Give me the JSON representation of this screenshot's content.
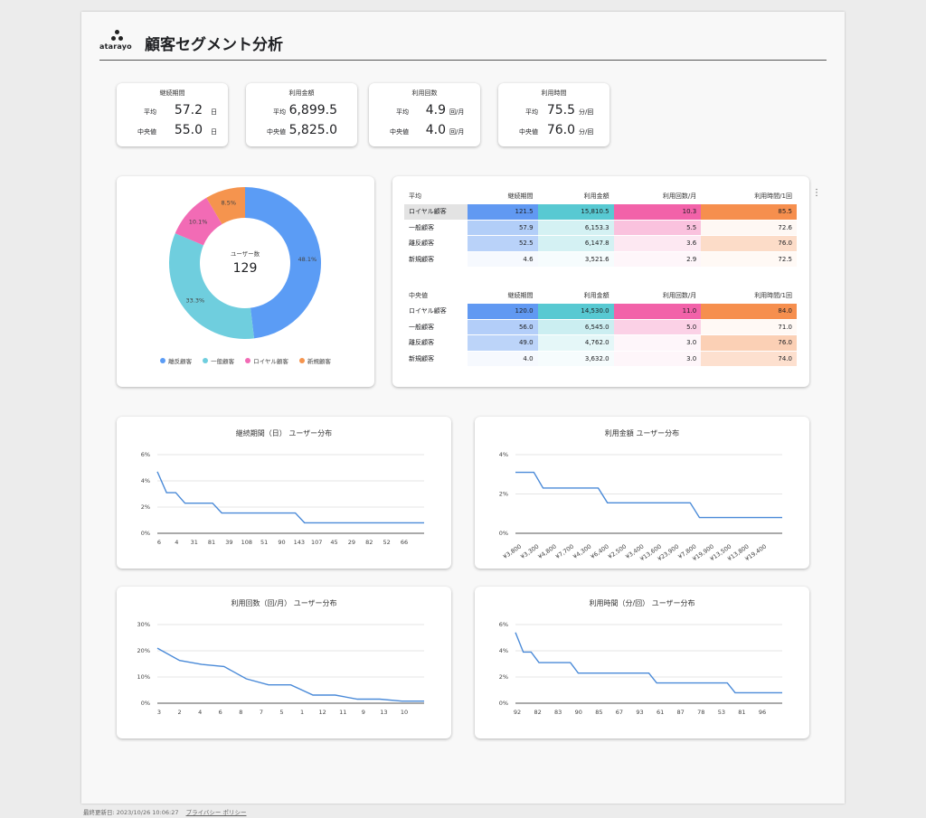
{
  "header": {
    "logo_text": "atarayo",
    "title": "顧客セグメント分析"
  },
  "kpis": [
    {
      "title": "継続期間",
      "avg_label": "平均",
      "avg": "57.2",
      "med_label": "中央値",
      "med": "55.0",
      "unit": "日"
    },
    {
      "title": "利用金額",
      "avg_label": "平均",
      "avg": "6,899.5",
      "med_label": "中央値",
      "med": "5,825.0",
      "unit": ""
    },
    {
      "title": "利用回数",
      "avg_label": "平均",
      "avg": "4.9",
      "med_label": "中央値",
      "med": "4.0",
      "unit": "回/月"
    },
    {
      "title": "利用時間",
      "avg_label": "平均",
      "avg": "75.5",
      "med_label": "中央値",
      "med": "76.0",
      "unit": "分/回"
    }
  ],
  "donut": {
    "center_label": "ユーザー数",
    "center_value": "129",
    "legend": [
      "離反顧客",
      "一般顧客",
      "ロイヤル顧客",
      "新規顧客"
    ]
  },
  "avg_table": {
    "headers": [
      "平均",
      "継続期間",
      "利用金額",
      "利用回数/月",
      "利用時間/1回"
    ],
    "rows": [
      [
        "ロイヤル顧客",
        "121.5",
        "15,810.5",
        "10.3",
        "85.5"
      ],
      [
        "一般顧客",
        "57.9",
        "6,153.3",
        "5.5",
        "72.6"
      ],
      [
        "離反顧客",
        "52.5",
        "6,147.8",
        "3.6",
        "76.0"
      ],
      [
        "新規顧客",
        "4.6",
        "3,521.6",
        "2.9",
        "72.5"
      ]
    ]
  },
  "med_table": {
    "headers": [
      "中央値",
      "継続期間",
      "利用金額",
      "利用回数/月",
      "利用時間/1回"
    ],
    "rows": [
      [
        "ロイヤル顧客",
        "120.0",
        "14,530.0",
        "11.0",
        "84.0"
      ],
      [
        "一般顧客",
        "56.0",
        "6,545.0",
        "5.0",
        "71.0"
      ],
      [
        "離反顧客",
        "49.0",
        "4,762.0",
        "3.0",
        "76.0"
      ],
      [
        "新規顧客",
        "4.0",
        "3,632.0",
        "3.0",
        "74.0"
      ]
    ]
  },
  "colors": {
    "blue": "#5b9cf5",
    "teal": "#6fcede",
    "pink": "#f26bb5",
    "orange": "#f5944e",
    "line": "#4a8ad8"
  },
  "footer": {
    "updated": "最終更新日: 2023/10/26 10:06:27",
    "privacy": "プライバシー ポリシー"
  },
  "chart_data": [
    {
      "type": "pie",
      "categories": [
        "離反顧客",
        "一般顧客",
        "ロイヤル顧客",
        "新規顧客"
      ],
      "values": [
        48.1,
        33.3,
        10.1,
        8.5
      ],
      "labels": [
        "48.1%",
        "33.3%",
        "10.1%",
        "8.5%"
      ],
      "total_label": "ユーザー数",
      "total": 129
    },
    {
      "type": "line",
      "title": "継続期間（日） ユーザー分布",
      "x": [
        "6",
        "4",
        "31",
        "81",
        "39",
        "108",
        "51",
        "90",
        "143",
        "107",
        "45",
        "29",
        "82",
        "52",
        "66"
      ],
      "y": [
        4.7,
        3.1,
        3.1,
        2.3,
        2.3,
        2.3,
        2.3,
        1.55,
        1.55,
        1.55,
        1.55,
        1.55,
        1.55,
        1.55,
        1.55,
        1.55,
        0.8,
        0.8,
        0.8,
        0.8,
        0.8,
        0.8,
        0.8,
        0.8,
        0.8,
        0.8,
        0.8,
        0.8,
        0.8,
        0.8
      ],
      "yticks": [
        "6%",
        "4%",
        "2%",
        "0%"
      ],
      "ylim": [
        0,
        6
      ]
    },
    {
      "type": "line",
      "title": "利用金額 ユーザー分布",
      "x": [
        "¥3,800",
        "¥3,300",
        "¥4,800",
        "¥7,700",
        "¥4,300",
        "¥6,400",
        "¥2,500",
        "¥3,400",
        "¥13,600",
        "¥23,900",
        "¥7,800",
        "¥19,900",
        "¥13,500",
        "¥13,800",
        "¥19,400"
      ],
      "y": [
        3.1,
        3.1,
        3.1,
        2.3,
        2.3,
        2.3,
        2.3,
        2.3,
        2.3,
        2.3,
        1.55,
        1.55,
        1.55,
        1.55,
        1.55,
        1.55,
        1.55,
        1.55,
        1.55,
        1.55,
        0.8,
        0.8,
        0.8,
        0.8,
        0.8,
        0.8,
        0.8,
        0.8,
        0.8,
        0.8
      ],
      "yticks": [
        "4%",
        "2%",
        "0%"
      ],
      "ylim": [
        0,
        4
      ]
    },
    {
      "type": "line",
      "title": "利用回数（回/月） ユーザー分布",
      "x": [
        "3",
        "2",
        "4",
        "6",
        "8",
        "7",
        "5",
        "1",
        "12",
        "11",
        "9",
        "13",
        "10"
      ],
      "y": [
        21,
        16.3,
        14.8,
        14,
        9.3,
        7,
        7,
        3.1,
        3.1,
        1.55,
        1.55,
        0.8,
        0.8
      ],
      "yticks": [
        "30%",
        "20%",
        "10%",
        "0%"
      ],
      "ylim": [
        0,
        30
      ]
    },
    {
      "type": "line",
      "title": "利用時間（分/回） ユーザー分布",
      "x": [
        "92",
        "82",
        "83",
        "90",
        "85",
        "67",
        "93",
        "61",
        "87",
        "78",
        "53",
        "81",
        "96"
      ],
      "y": [
        5.4,
        3.9,
        3.9,
        3.1,
        3.1,
        3.1,
        3.1,
        3.1,
        2.3,
        2.3,
        2.3,
        2.3,
        2.3,
        2.3,
        2.3,
        2.3,
        2.3,
        2.3,
        1.55,
        1.55,
        1.55,
        1.55,
        1.55,
        1.55,
        1.55,
        1.55,
        1.55,
        1.55,
        0.8,
        0.8,
        0.8,
        0.8,
        0.8,
        0.8,
        0.8
      ],
      "yticks": [
        "6%",
        "4%",
        "2%",
        "0%"
      ],
      "ylim": [
        0,
        6
      ]
    }
  ]
}
